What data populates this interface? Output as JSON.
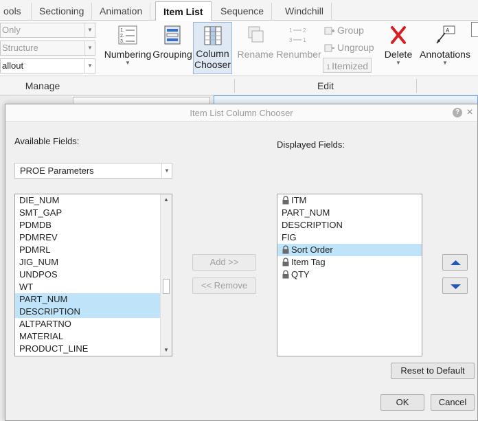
{
  "ribbon": {
    "tabs": [
      {
        "label": "ools",
        "active": false
      },
      {
        "label": "Sectioning",
        "active": false
      },
      {
        "label": "Animation",
        "active": false
      },
      {
        "label": "Item List",
        "active": true
      },
      {
        "label": "Sequence",
        "active": false
      },
      {
        "label": "Windchill",
        "active": false
      }
    ],
    "combos": [
      "Only",
      "Structure",
      "allout"
    ],
    "buttons": {
      "numbering": "Numbering",
      "grouping": "Grouping",
      "column_chooser_1": "Column",
      "column_chooser_2": "Chooser",
      "rename": "Rename",
      "renumber": "Renumber",
      "group": "Group",
      "ungroup": "Ungroup",
      "itemized": "Itemized",
      "delete": "Delete",
      "annotations": "Annotations"
    },
    "groups": {
      "manage": "Manage",
      "edit": "Edit"
    }
  },
  "dialog": {
    "title": "Item List Column Chooser",
    "available_label": "Available Fields:",
    "displayed_label": "Displayed Fields:",
    "source_selected": "PROE Parameters",
    "available_fields": [
      {
        "label": "DIE_NUM",
        "selected": false
      },
      {
        "label": "SMT_GAP",
        "selected": false
      },
      {
        "label": "PDMDB",
        "selected": false
      },
      {
        "label": "PDMREV",
        "selected": false
      },
      {
        "label": "PDMRL",
        "selected": false
      },
      {
        "label": "JIG_NUM",
        "selected": false
      },
      {
        "label": "UNDPOS",
        "selected": false
      },
      {
        "label": "WT",
        "selected": false
      },
      {
        "label": "PART_NUM",
        "selected": true
      },
      {
        "label": "DESCRIPTION",
        "selected": true
      },
      {
        "label": "ALTPARTNO",
        "selected": false
      },
      {
        "label": "MATERIAL",
        "selected": false
      },
      {
        "label": "PRODUCT_LINE",
        "selected": false
      }
    ],
    "displayed_fields": [
      {
        "label": "ITM",
        "locked": true,
        "selected": false
      },
      {
        "label": "PART_NUM",
        "locked": false,
        "selected": false
      },
      {
        "label": "DESCRIPTION",
        "locked": false,
        "selected": false
      },
      {
        "label": "FIG",
        "locked": false,
        "selected": false
      },
      {
        "label": "Sort Order",
        "locked": true,
        "selected": true
      },
      {
        "label": "Item Tag",
        "locked": true,
        "selected": false
      },
      {
        "label": "QTY",
        "locked": true,
        "selected": false
      }
    ],
    "add_button": "Add >>",
    "remove_button": "<< Remove",
    "reset_button": "Reset to Default",
    "ok_button": "OK",
    "cancel_button": "Cancel",
    "help_glyph": "?",
    "close_glyph": "×",
    "colors": {
      "selection": "#bfe3f8",
      "arrow_blue": "#2457b8"
    }
  }
}
